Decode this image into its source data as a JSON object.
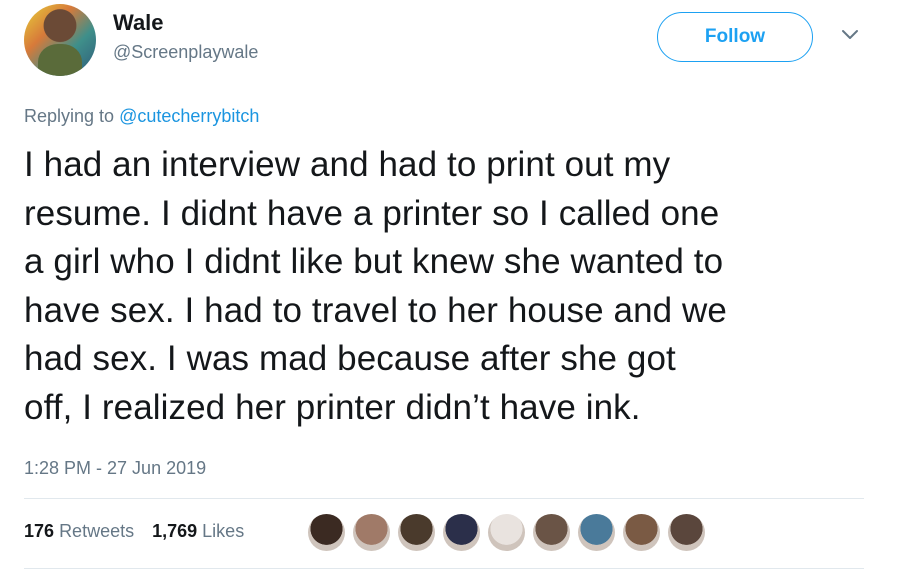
{
  "author": {
    "name": "Wale",
    "handle": "@Screenplaywale"
  },
  "follow_label": "Follow",
  "reply": {
    "prefix": "Replying to",
    "mention": "@cutecherrybitch"
  },
  "tweet": {
    "lines": [
      "I had an interview and had to print out my",
      "resume. I didnt have a printer so I called one",
      "a girl who I didnt like but knew she wanted to",
      "have sex. I had to travel to her house and we",
      "had sex. I was mad because after she got",
      "off, I realized her printer didn’t have ink."
    ]
  },
  "timestamp": "1:28 PM - 27 Jun 2019",
  "stats": {
    "retweets_count": "176",
    "retweets_label": "Retweets",
    "likes_count": "1,769",
    "likes_label": "Likes"
  },
  "colors": {
    "accent": "#1da1f2",
    "text": "#14171a",
    "secondary": "#657786"
  },
  "liker_avatar_colors": [
    "#3b2a22",
    "#a07a68",
    "#4a3a2c",
    "#2b2f4a",
    "#e9e3df",
    "#6a5446",
    "#4a7a9a",
    "#7a5a44",
    "#5a463c"
  ]
}
